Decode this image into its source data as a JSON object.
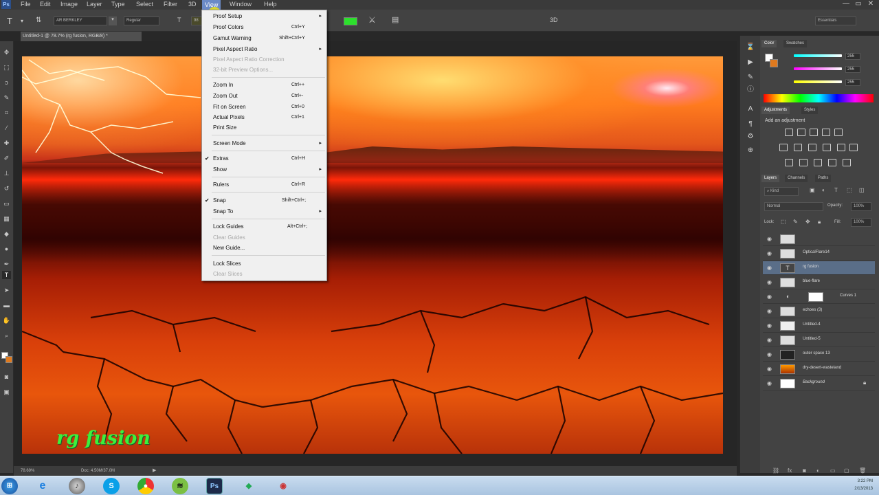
{
  "menubar": {
    "app_logo": "Ps",
    "items": [
      "File",
      "Edit",
      "Image",
      "Layer",
      "Type",
      "Select",
      "Filter",
      "3D",
      "View",
      "Window",
      "Help"
    ],
    "active_item": "View",
    "window_controls": [
      "—",
      "▭",
      "✕"
    ]
  },
  "options_bar": {
    "tool_glyph": "T",
    "font_family": "AR BERKLEY",
    "font_style": "Regular",
    "font_size": "98",
    "color_swatch": "#2ce02c",
    "workspace": "Essentials"
  },
  "document_tab": {
    "title": "Untitled-1 @ 78.7% (rg fusion, RGB/8) *"
  },
  "view_menu": {
    "items": [
      {
        "label": "Proof Setup",
        "shortcut": "",
        "submenu": true,
        "disabled": false,
        "checked": false
      },
      {
        "label": "Proof Colors",
        "shortcut": "Ctrl+Y",
        "submenu": false,
        "disabled": false,
        "checked": false
      },
      {
        "label": "Gamut Warning",
        "shortcut": "Shift+Ctrl+Y",
        "submenu": false,
        "disabled": false,
        "checked": false
      },
      {
        "label": "Pixel Aspect Ratio",
        "shortcut": "",
        "submenu": true,
        "disabled": false,
        "checked": false
      },
      {
        "label": "Pixel Aspect Ratio Correction",
        "shortcut": "",
        "submenu": false,
        "disabled": true,
        "checked": false
      },
      {
        "label": "32-bit Preview Options...",
        "shortcut": "",
        "submenu": false,
        "disabled": true,
        "checked": false
      },
      {
        "label": "Zoom In",
        "shortcut": "Ctrl++",
        "submenu": false,
        "disabled": false,
        "checked": false
      },
      {
        "label": "Zoom Out",
        "shortcut": "Ctrl+-",
        "submenu": false,
        "disabled": false,
        "checked": false
      },
      {
        "label": "Fit on Screen",
        "shortcut": "Ctrl+0",
        "submenu": false,
        "disabled": false,
        "checked": false
      },
      {
        "label": "Actual Pixels",
        "shortcut": "Ctrl+1",
        "submenu": false,
        "disabled": false,
        "checked": false
      },
      {
        "label": "Print Size",
        "shortcut": "",
        "submenu": false,
        "disabled": false,
        "checked": false
      },
      {
        "label": "Screen Mode",
        "shortcut": "",
        "submenu": true,
        "disabled": false,
        "checked": false
      },
      {
        "label": "Extras",
        "shortcut": "Ctrl+H",
        "submenu": false,
        "disabled": false,
        "checked": true
      },
      {
        "label": "Show",
        "shortcut": "",
        "submenu": true,
        "disabled": false,
        "checked": false
      },
      {
        "label": "Rulers",
        "shortcut": "Ctrl+R",
        "submenu": false,
        "disabled": false,
        "checked": false
      },
      {
        "label": "Snap",
        "shortcut": "Shift+Ctrl+;",
        "submenu": false,
        "disabled": false,
        "checked": true
      },
      {
        "label": "Snap To",
        "shortcut": "",
        "submenu": true,
        "disabled": false,
        "checked": false
      },
      {
        "label": "Lock Guides",
        "shortcut": "Alt+Ctrl+;",
        "submenu": false,
        "disabled": false,
        "checked": false
      },
      {
        "label": "Clear Guides",
        "shortcut": "",
        "submenu": false,
        "disabled": true,
        "checked": false
      },
      {
        "label": "New Guide...",
        "shortcut": "",
        "submenu": false,
        "disabled": false,
        "checked": false
      },
      {
        "label": "Lock Slices",
        "shortcut": "",
        "submenu": false,
        "disabled": false,
        "checked": false
      },
      {
        "label": "Clear Slices",
        "shortcut": "",
        "submenu": false,
        "disabled": true,
        "checked": false
      }
    ]
  },
  "canvas": {
    "watermark": "rg fusion"
  },
  "color_panel": {
    "tabs": [
      "Color",
      "Swatches"
    ],
    "values": [
      "255",
      "255",
      "255"
    ]
  },
  "adjustments_panel": {
    "tabs": [
      "Adjustments",
      "Styles"
    ],
    "heading": "Add an adjustment"
  },
  "layers_panel": {
    "tabs": [
      "Layers",
      "Channels",
      "Paths"
    ],
    "kind_filter": "Kind",
    "blend_mode": "Normal",
    "opacity_label": "Opacity:",
    "opacity_value": "100%",
    "lock_label": "Lock:",
    "fill_label": "Fill:",
    "fill_value": "100%",
    "layers": [
      {
        "name": "",
        "selected": false
      },
      {
        "name": "OpticalFlare14",
        "selected": false
      },
      {
        "name": "rg fusion",
        "selected": true
      },
      {
        "name": "blue-flare",
        "selected": false
      },
      {
        "name": "Curves 1",
        "selected": false
      },
      {
        "name": "echoes (3)",
        "selected": false
      },
      {
        "name": "Untitled-4",
        "selected": false
      },
      {
        "name": "Untitled-5",
        "selected": false
      },
      {
        "name": "outer space 13",
        "selected": false
      },
      {
        "name": "dry-desert-wasteland",
        "selected": false
      },
      {
        "name": "Background",
        "selected": false
      }
    ]
  },
  "status_bar": {
    "zoom": "78.69%",
    "doc_info": "Doc: 4.50M/37.0M"
  },
  "taskbar": {
    "apps": [
      "start",
      "ie",
      "itunes",
      "skype",
      "chrome",
      "spotify",
      "photoshop",
      "app1",
      "app2"
    ],
    "time": "3:22 PM",
    "date": "2/13/2013"
  }
}
